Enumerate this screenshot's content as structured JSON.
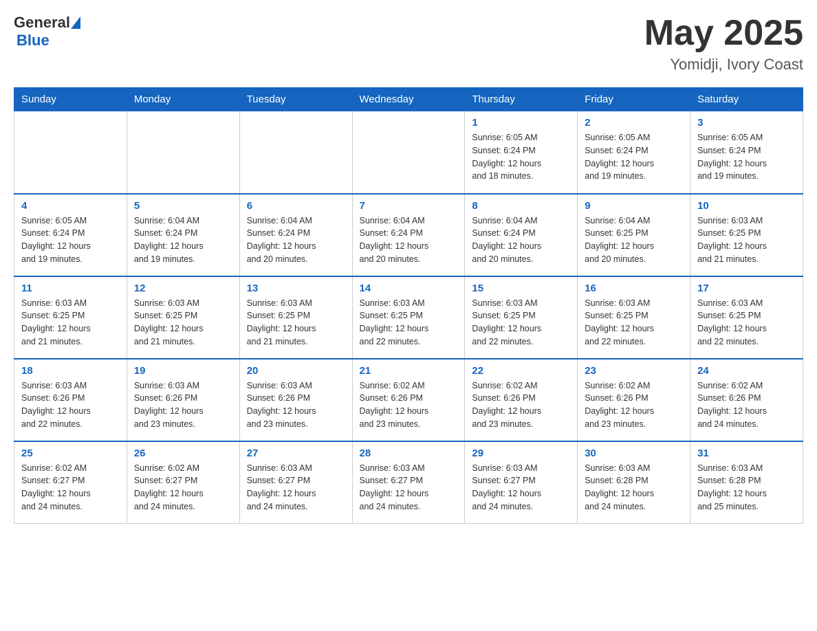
{
  "header": {
    "logo_general": "General",
    "logo_blue": "Blue",
    "month_title": "May 2025",
    "location": "Yomidji, Ivory Coast"
  },
  "weekdays": [
    "Sunday",
    "Monday",
    "Tuesday",
    "Wednesday",
    "Thursday",
    "Friday",
    "Saturday"
  ],
  "weeks": [
    [
      {
        "day": "",
        "info": ""
      },
      {
        "day": "",
        "info": ""
      },
      {
        "day": "",
        "info": ""
      },
      {
        "day": "",
        "info": ""
      },
      {
        "day": "1",
        "info": "Sunrise: 6:05 AM\nSunset: 6:24 PM\nDaylight: 12 hours\nand 18 minutes."
      },
      {
        "day": "2",
        "info": "Sunrise: 6:05 AM\nSunset: 6:24 PM\nDaylight: 12 hours\nand 19 minutes."
      },
      {
        "day": "3",
        "info": "Sunrise: 6:05 AM\nSunset: 6:24 PM\nDaylight: 12 hours\nand 19 minutes."
      }
    ],
    [
      {
        "day": "4",
        "info": "Sunrise: 6:05 AM\nSunset: 6:24 PM\nDaylight: 12 hours\nand 19 minutes."
      },
      {
        "day": "5",
        "info": "Sunrise: 6:04 AM\nSunset: 6:24 PM\nDaylight: 12 hours\nand 19 minutes."
      },
      {
        "day": "6",
        "info": "Sunrise: 6:04 AM\nSunset: 6:24 PM\nDaylight: 12 hours\nand 20 minutes."
      },
      {
        "day": "7",
        "info": "Sunrise: 6:04 AM\nSunset: 6:24 PM\nDaylight: 12 hours\nand 20 minutes."
      },
      {
        "day": "8",
        "info": "Sunrise: 6:04 AM\nSunset: 6:24 PM\nDaylight: 12 hours\nand 20 minutes."
      },
      {
        "day": "9",
        "info": "Sunrise: 6:04 AM\nSunset: 6:25 PM\nDaylight: 12 hours\nand 20 minutes."
      },
      {
        "day": "10",
        "info": "Sunrise: 6:03 AM\nSunset: 6:25 PM\nDaylight: 12 hours\nand 21 minutes."
      }
    ],
    [
      {
        "day": "11",
        "info": "Sunrise: 6:03 AM\nSunset: 6:25 PM\nDaylight: 12 hours\nand 21 minutes."
      },
      {
        "day": "12",
        "info": "Sunrise: 6:03 AM\nSunset: 6:25 PM\nDaylight: 12 hours\nand 21 minutes."
      },
      {
        "day": "13",
        "info": "Sunrise: 6:03 AM\nSunset: 6:25 PM\nDaylight: 12 hours\nand 21 minutes."
      },
      {
        "day": "14",
        "info": "Sunrise: 6:03 AM\nSunset: 6:25 PM\nDaylight: 12 hours\nand 22 minutes."
      },
      {
        "day": "15",
        "info": "Sunrise: 6:03 AM\nSunset: 6:25 PM\nDaylight: 12 hours\nand 22 minutes."
      },
      {
        "day": "16",
        "info": "Sunrise: 6:03 AM\nSunset: 6:25 PM\nDaylight: 12 hours\nand 22 minutes."
      },
      {
        "day": "17",
        "info": "Sunrise: 6:03 AM\nSunset: 6:25 PM\nDaylight: 12 hours\nand 22 minutes."
      }
    ],
    [
      {
        "day": "18",
        "info": "Sunrise: 6:03 AM\nSunset: 6:26 PM\nDaylight: 12 hours\nand 22 minutes."
      },
      {
        "day": "19",
        "info": "Sunrise: 6:03 AM\nSunset: 6:26 PM\nDaylight: 12 hours\nand 23 minutes."
      },
      {
        "day": "20",
        "info": "Sunrise: 6:03 AM\nSunset: 6:26 PM\nDaylight: 12 hours\nand 23 minutes."
      },
      {
        "day": "21",
        "info": "Sunrise: 6:02 AM\nSunset: 6:26 PM\nDaylight: 12 hours\nand 23 minutes."
      },
      {
        "day": "22",
        "info": "Sunrise: 6:02 AM\nSunset: 6:26 PM\nDaylight: 12 hours\nand 23 minutes."
      },
      {
        "day": "23",
        "info": "Sunrise: 6:02 AM\nSunset: 6:26 PM\nDaylight: 12 hours\nand 23 minutes."
      },
      {
        "day": "24",
        "info": "Sunrise: 6:02 AM\nSunset: 6:26 PM\nDaylight: 12 hours\nand 24 minutes."
      }
    ],
    [
      {
        "day": "25",
        "info": "Sunrise: 6:02 AM\nSunset: 6:27 PM\nDaylight: 12 hours\nand 24 minutes."
      },
      {
        "day": "26",
        "info": "Sunrise: 6:02 AM\nSunset: 6:27 PM\nDaylight: 12 hours\nand 24 minutes."
      },
      {
        "day": "27",
        "info": "Sunrise: 6:03 AM\nSunset: 6:27 PM\nDaylight: 12 hours\nand 24 minutes."
      },
      {
        "day": "28",
        "info": "Sunrise: 6:03 AM\nSunset: 6:27 PM\nDaylight: 12 hours\nand 24 minutes."
      },
      {
        "day": "29",
        "info": "Sunrise: 6:03 AM\nSunset: 6:27 PM\nDaylight: 12 hours\nand 24 minutes."
      },
      {
        "day": "30",
        "info": "Sunrise: 6:03 AM\nSunset: 6:28 PM\nDaylight: 12 hours\nand 24 minutes."
      },
      {
        "day": "31",
        "info": "Sunrise: 6:03 AM\nSunset: 6:28 PM\nDaylight: 12 hours\nand 25 minutes."
      }
    ]
  ]
}
